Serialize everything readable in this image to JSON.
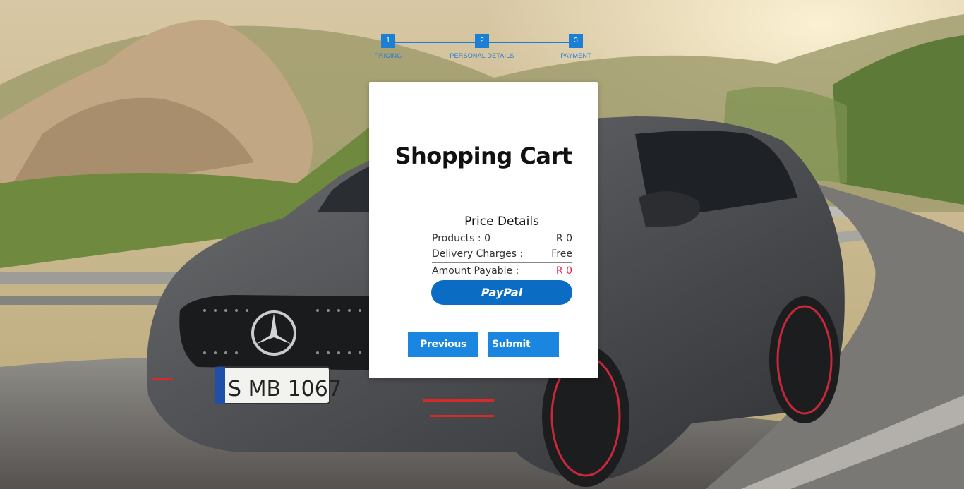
{
  "stepper": {
    "steps": [
      {
        "number": "1",
        "label": "PRICING"
      },
      {
        "number": "2",
        "label": "PERSONAL DETAILS"
      },
      {
        "number": "3",
        "label": "PAYMENT"
      }
    ]
  },
  "card": {
    "title": "Shopping Cart",
    "price_details": {
      "heading": "Price Details",
      "products_label": "Products : 0",
      "products_value": "R 0",
      "delivery_label": "Delivery Charges :",
      "delivery_value": "Free",
      "amount_label": "Amount Payable :",
      "amount_value": "R 0"
    },
    "paypal_label": "PayPal",
    "previous_label": "Previous",
    "submit_label": "Submit"
  },
  "background": {
    "plate_text": "S MB 1067"
  },
  "colors": {
    "accent": "#1b86e0",
    "paypal": "#0a6cc2",
    "amount_red": "#e8294a"
  }
}
